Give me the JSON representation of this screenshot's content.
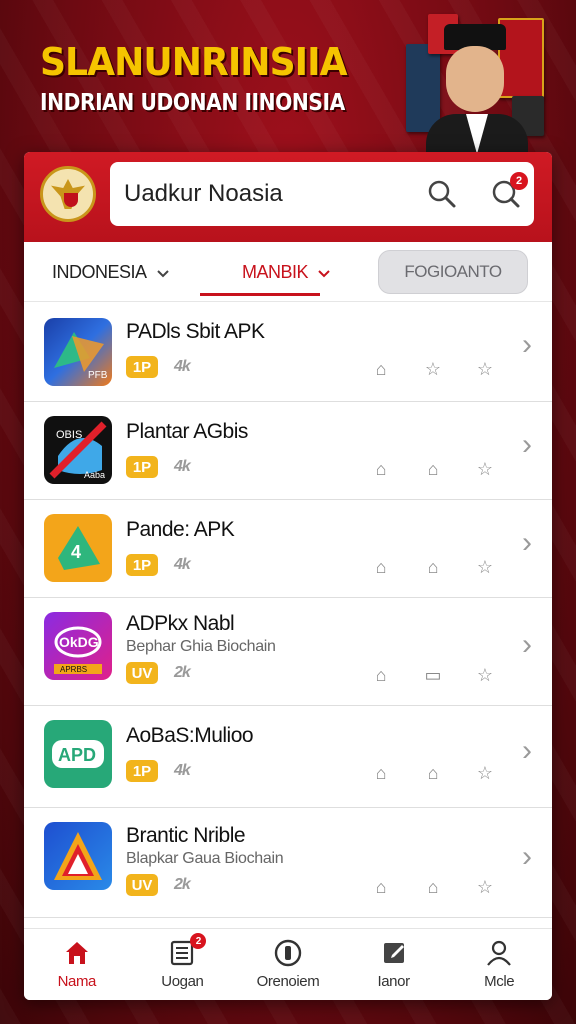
{
  "banner": {
    "title": "SLANUNRINSIIA",
    "subtitle": "INDRIAN UDONAN IINONSIA"
  },
  "search": {
    "value": "Uadkur Noasia",
    "notification_count": "2"
  },
  "filters": {
    "country": "INDONESIA",
    "category": "MANBIK",
    "button": "FOGIOANTO"
  },
  "apps": [
    {
      "title": "PADls Sbit APK",
      "subtitle": "",
      "badge": "1P",
      "rating": "4k"
    },
    {
      "title": "Plantar AGbis",
      "subtitle": "",
      "badge": "1P",
      "rating": "4k"
    },
    {
      "title": "Pande: APK",
      "subtitle": "",
      "badge": "1P",
      "rating": "4k"
    },
    {
      "title": "ADPkx Nabl",
      "subtitle": "Bephar Ghia Biochain",
      "badge": "UV",
      "rating": "2k"
    },
    {
      "title": "AoBaS:Mulioo",
      "subtitle": "",
      "badge": "1P",
      "rating": "4k"
    },
    {
      "title": "Brantic Nrible",
      "subtitle": "Blapkar Gaua Biochain",
      "badge": "UV",
      "rating": "2k"
    }
  ],
  "app_icon_text": {
    "app1": "PFB",
    "app2_top": "OBIS",
    "app2_bottom": "Aaba",
    "app4_top": "OkDG",
    "app4_bottom": "APRBS",
    "app5": "APD"
  },
  "tabs": [
    {
      "label": "Nama",
      "icon": "home-icon"
    },
    {
      "label": "Uogan",
      "icon": "list-icon",
      "badge": "2"
    },
    {
      "label": "Orenoiem",
      "icon": "circle-icon"
    },
    {
      "label": "Ianor",
      "icon": "note-icon"
    },
    {
      "label": "Mcle",
      "icon": "person-icon"
    }
  ],
  "colors": {
    "brand_red": "#c8121c",
    "badge_yellow": "#f2b41c",
    "headline_yellow": "#f5c400"
  }
}
